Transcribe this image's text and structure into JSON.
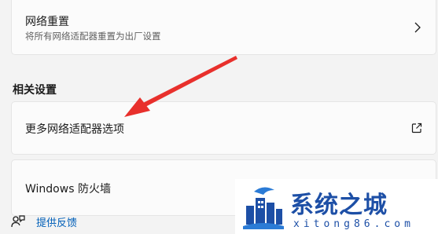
{
  "network_reset": {
    "title": "网络重置",
    "subtitle": "将所有网络适配器重置为出厂设置",
    "icon": "chevron-right-icon"
  },
  "related_settings": {
    "heading": "相关设置",
    "items": [
      {
        "label": "更多网络适配器选项",
        "icon": "external-link-icon"
      },
      {
        "label": "Windows 防火墙"
      }
    ]
  },
  "feedback": {
    "label": "提供反馈",
    "icon": "feedback-person-icon"
  },
  "annotation": {
    "type": "arrow",
    "color": "#e8302c"
  },
  "watermark": {
    "name": "系统之城",
    "domain": "xitong86.com",
    "color": "#1d4fa6"
  }
}
